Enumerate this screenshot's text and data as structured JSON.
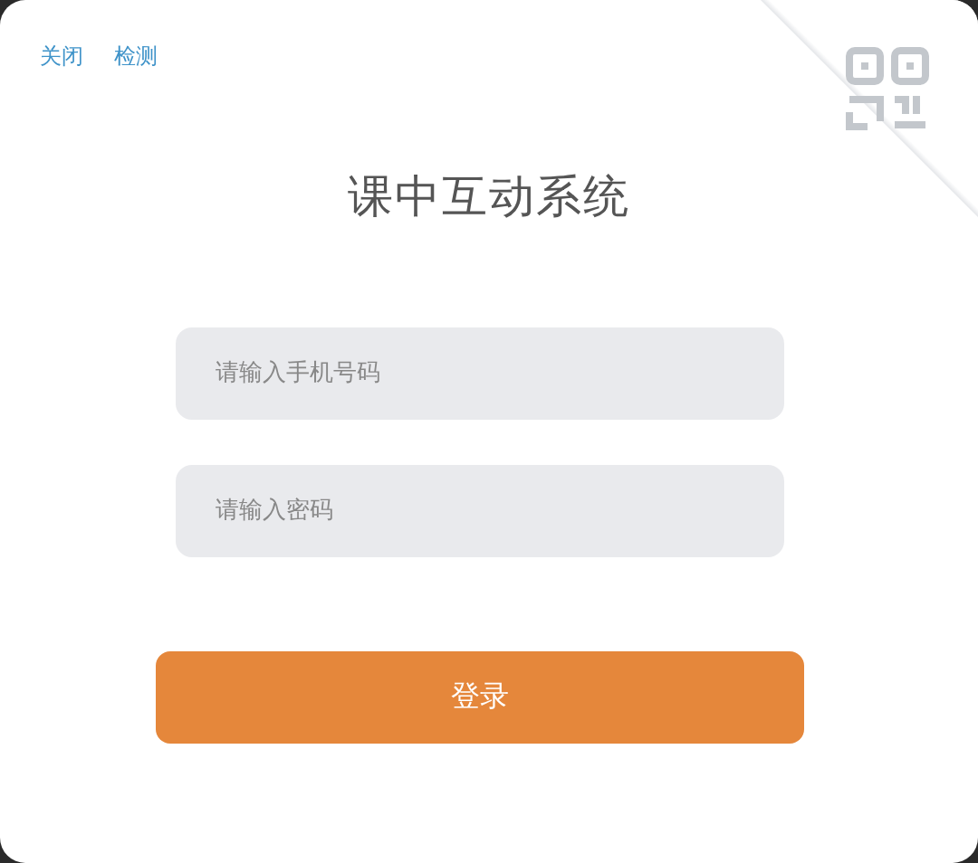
{
  "top_links": [
    {
      "label": "关闭"
    },
    {
      "label": "检测"
    }
  ],
  "title": "课中互动系统",
  "fields": [
    {
      "placeholder": "请输入手机号码"
    },
    {
      "placeholder": "请输入密码"
    }
  ],
  "login_button": "登录"
}
